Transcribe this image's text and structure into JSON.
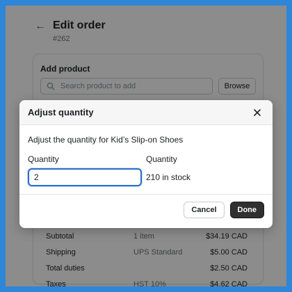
{
  "page": {
    "title": "Edit order",
    "order_number": "#262"
  },
  "add_product": {
    "title": "Add product",
    "search_placeholder": "Search product to add",
    "browse_label": "Browse"
  },
  "summary": [
    {
      "label": "Subtotal",
      "detail": "1 item",
      "amount": "$34.19 CAD"
    },
    {
      "label": "Shipping",
      "detail": "UPS Standard",
      "amount": "$5.00 CAD"
    },
    {
      "label": "Total duties",
      "detail": "",
      "amount": "$2.50 CAD"
    },
    {
      "label": "Taxes",
      "detail": "HST 10%",
      "amount": "$4.62 CAD"
    }
  ],
  "modal": {
    "title": "Adjust quantity",
    "description": "Adjust the quantity for Kid’s Slip-on Shoes",
    "quantity_label": "Quantity",
    "quantity_value": "2",
    "stock_label": "Quantity",
    "stock_value": "210 in stock",
    "cancel_label": "Cancel",
    "done_label": "Done"
  },
  "colors": {
    "frame_border": "#2f85d8",
    "input_focus": "#2c6ecb",
    "primary_button": "#303030"
  },
  "icons": {
    "back": "arrow-left-icon",
    "search": "search-icon",
    "close": "close-icon"
  }
}
